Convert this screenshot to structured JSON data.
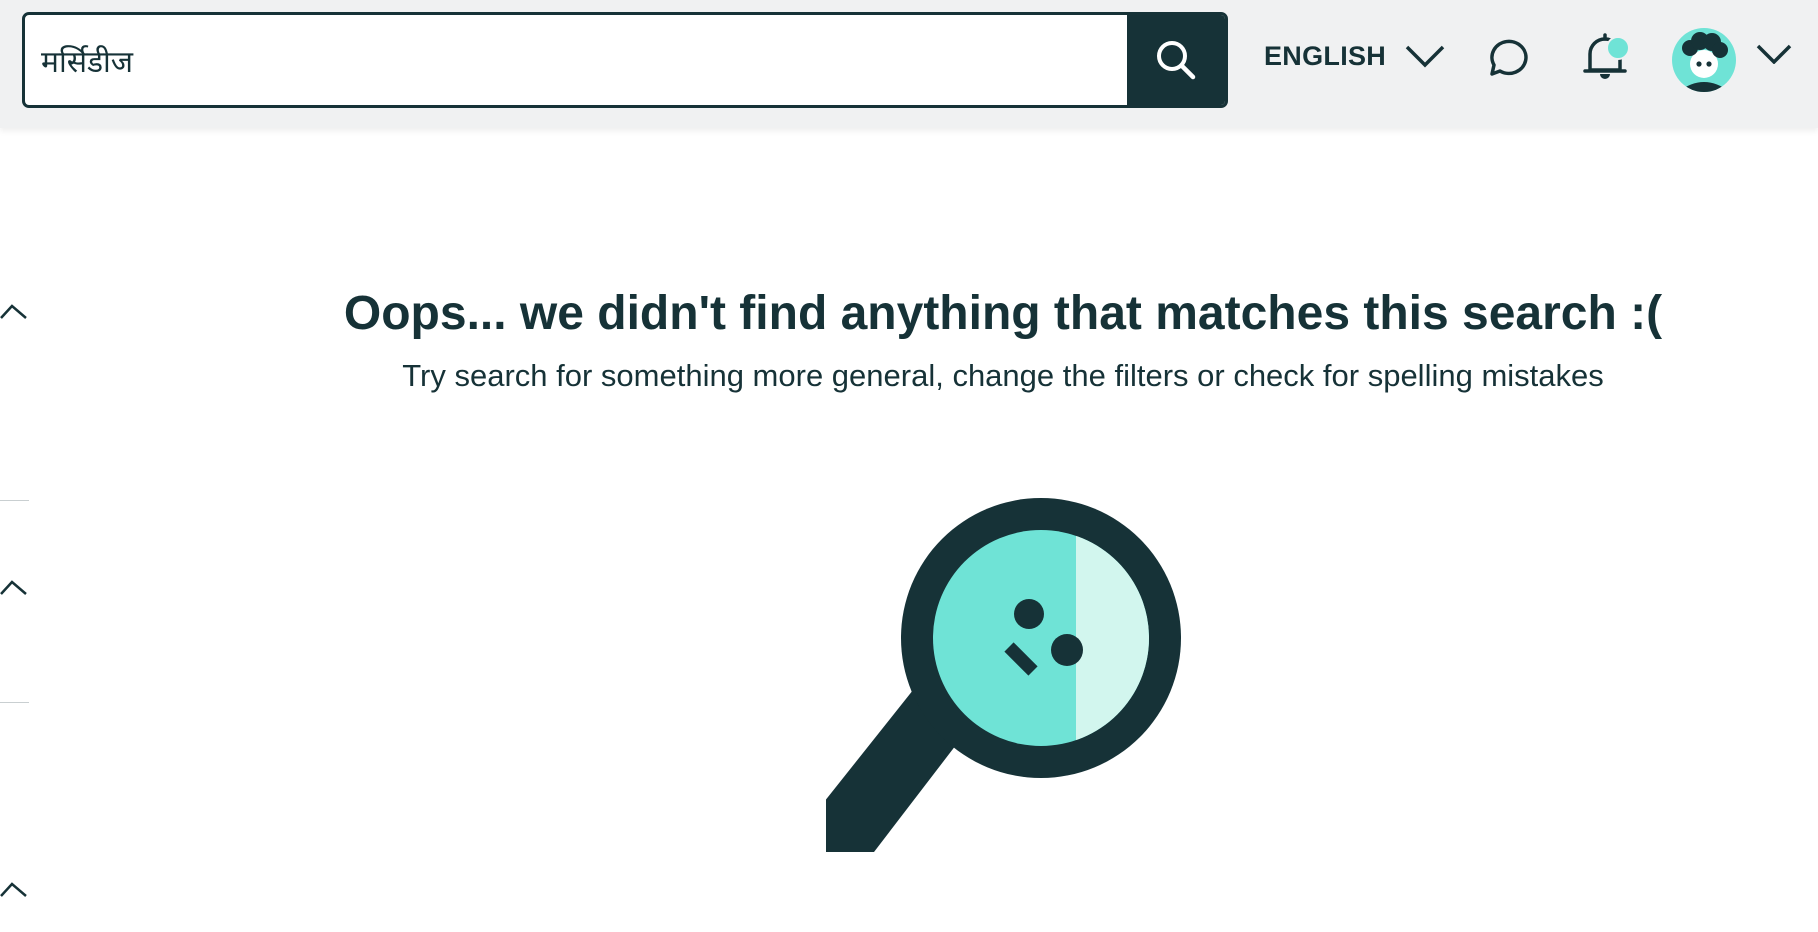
{
  "header": {
    "search": {
      "value": "मर्सिडीज",
      "placeholder": ""
    },
    "language": {
      "label": "ENGLISH"
    },
    "notifications": {
      "has_unread": true
    },
    "icons": [
      "search-icon",
      "chevron-down-icon",
      "chat-icon",
      "bell-icon",
      "avatar",
      "chevron-down-icon"
    ]
  },
  "sidebar": {
    "sections": [
      {
        "state": "expanded",
        "icon": "chevron-up-icon"
      },
      {
        "state": "expanded",
        "icon": "chevron-up-icon"
      },
      {
        "state": "expanded",
        "icon": "chevron-up-icon"
      }
    ]
  },
  "empty_state": {
    "title": "Oops... we didn't find anything that matches this search :(",
    "subtitle": "Try search for something more general, change the filters or check for spelling mistakes",
    "illustration": "magnifying-glass-sad-face"
  },
  "colors": {
    "primary": "#163237",
    "accent": "#6fe3d6",
    "accent_light": "#d2f6ee",
    "header_bg": "#f0f1f2",
    "page_bg": "#ffffff"
  }
}
